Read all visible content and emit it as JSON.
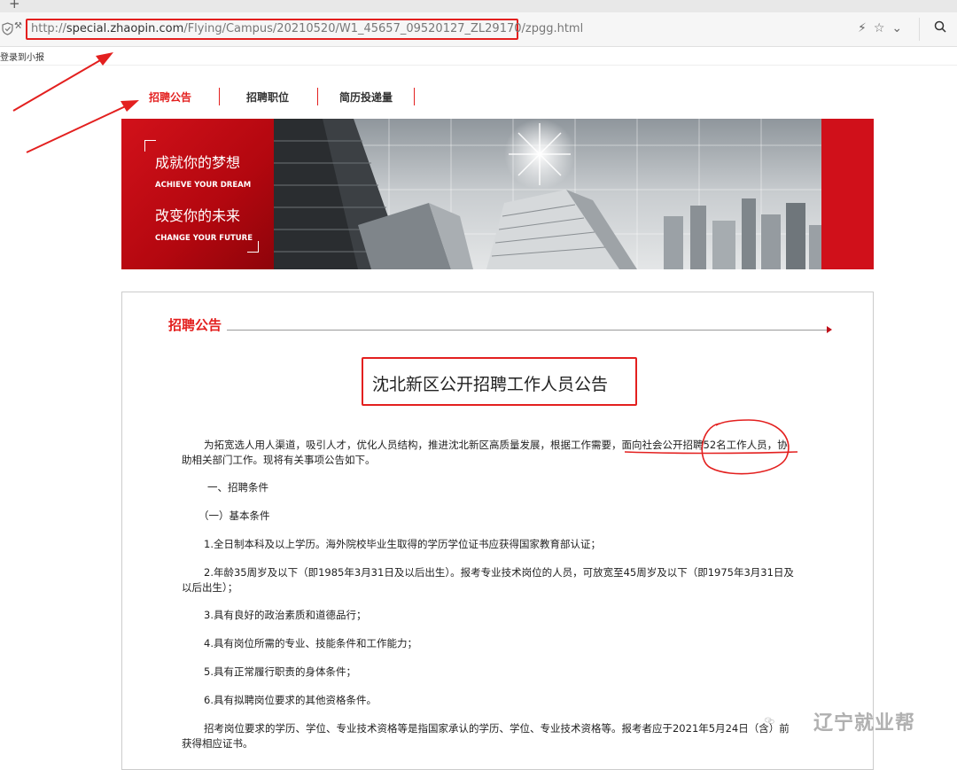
{
  "browser": {
    "new_tab_symbol": "+",
    "url_prefix": "http://",
    "url_domain": "special.zhaopin.com",
    "url_path": "/Flying/Campus/20210520/W1_45657_09520127_ZL29170/zpgg.html",
    "bookmark_label": "登录到小报"
  },
  "site_nav": {
    "items": [
      {
        "label": "招聘公告",
        "active": true
      },
      {
        "label": "招聘职位",
        "active": false
      },
      {
        "label": "简历投递量",
        "active": false
      }
    ]
  },
  "banner": {
    "slogan1": "成就你的梦想",
    "slogan1_en": "ACHIEVE YOUR DREAM",
    "slogan2": "改变你的未来",
    "slogan2_en": "CHANGE YOUR FUTURE"
  },
  "content": {
    "section_title": "招聘公告",
    "headline": "沈北新区公开招聘工作人员公告",
    "intro_line1_a": "为拓宽选人用人渠道，吸引人才，优化人员结构，推进沈北新区高质量发展，根据工作需要，",
    "intro_line1_b": "面向社会公开招聘52名工作人员",
    "intro_line1_c": "，协",
    "intro_line2": "助相关部门工作。现将有关事项公告如下。",
    "sec1": "一、招聘条件",
    "sub1": "（一）基本条件",
    "item1": "1.全日制本科及以上学历。海外院校毕业生取得的学历学位证书应获得国家教育部认证；",
    "item2_line1": "2.年龄35周岁及以下（即1985年3月31日及以后出生）。报考专业技术岗位的人员，可放宽至45周岁及以下（即1975年3月31日及",
    "item2_line2": "以后出生）；",
    "item3": "3.具有良好的政治素质和道德品行；",
    "item4": "4.具有岗位所需的专业、技能条件和工作能力；",
    "item5": "5.具有正常履行职责的身体条件；",
    "item6": "6.具有拟聘岗位要求的其他资格条件。",
    "item7_line1": "招考岗位要求的学历、学位、专业技术资格等是指国家承认的学历、学位、专业技术资格等。报考者应于2021年5月24日（含）前",
    "item7_line2": "获得相应证书。"
  },
  "watermark": {
    "text": "辽宁就业帮"
  },
  "colors": {
    "accent_red": "#e3201f",
    "banner_red": "#d0101a"
  }
}
